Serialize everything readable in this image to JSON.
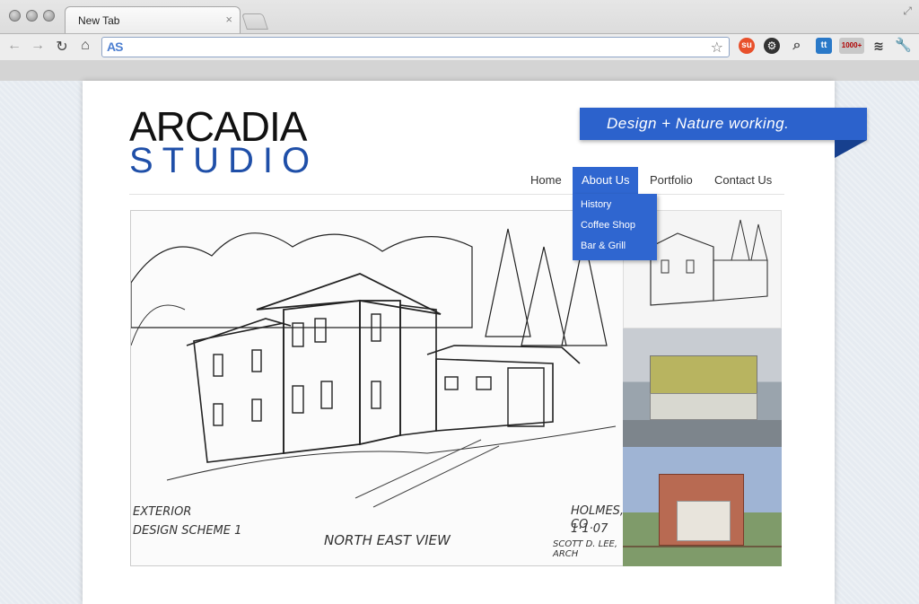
{
  "browser": {
    "tab_title": "New Tab",
    "tab_close": "×",
    "url": "",
    "omnibox_badge": "AS",
    "extensions": {
      "counter_label": "1000+",
      "tt_label": "tt"
    }
  },
  "site": {
    "logo_top": "ARCADIA",
    "logo_bottom": "STUDIO",
    "tagline": "Design + Nature working.",
    "menu": [
      {
        "label": "Home"
      },
      {
        "label": "About Us"
      },
      {
        "label": "Portfolio"
      },
      {
        "label": "Contact Us"
      }
    ],
    "dropdown": [
      {
        "label": "History"
      },
      {
        "label": "Coffee Shop"
      },
      {
        "label": "Bar & Grill"
      }
    ],
    "sketch_labels": {
      "left_top": "EXTERIOR",
      "left_bottom": "DESIGN SCHEME 1",
      "center": "NORTH EAST VIEW",
      "right_top": "HOLMES, CO",
      "right_mid": "1·1·07",
      "right_bottom": "SCOTT D. LEE, ARCH"
    }
  },
  "colors": {
    "accent": "#2f66d0",
    "ribbon": "#2c62cc",
    "logo_blue": "#1f4fa8"
  },
  "icons": [
    "back-icon",
    "forward-icon",
    "reload-icon",
    "home-icon",
    "star-icon",
    "stumbleupon-icon",
    "gear-icon",
    "magnifier-icon",
    "tt-icon",
    "counter-icon",
    "layers-icon",
    "wrench-icon"
  ]
}
